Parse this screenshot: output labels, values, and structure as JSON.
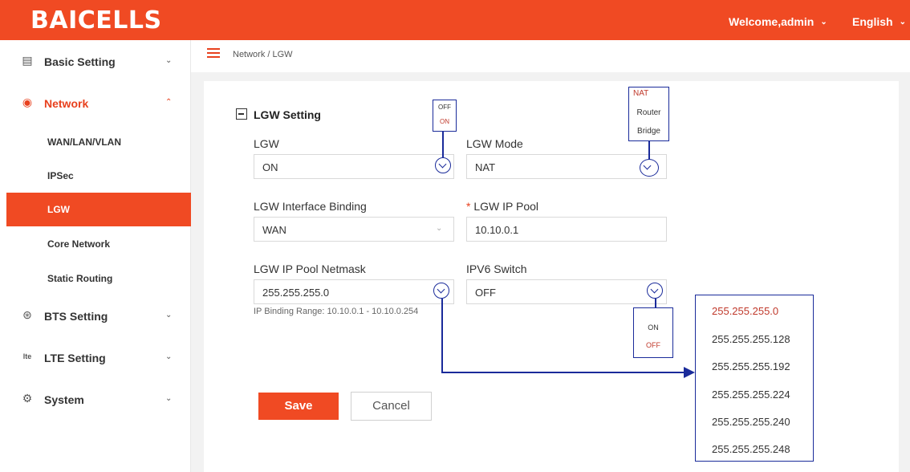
{
  "header": {
    "logo": "BAICELLS",
    "welcome": "Welcome,admin",
    "language": "English"
  },
  "sidebar": {
    "menus": [
      {
        "label": "Basic Setting",
        "icon": "document-icon"
      },
      {
        "label": "Network",
        "icon": "globe-icon"
      },
      {
        "label": "BTS Setting",
        "icon": "antenna-icon"
      },
      {
        "label": "LTE Setting",
        "icon": "lte-icon"
      },
      {
        "label": "System",
        "icon": "gear-icon"
      }
    ],
    "network_items": [
      "WAN/LAN/VLAN",
      "IPSec",
      "LGW",
      "Core Network",
      "Static Routing"
    ]
  },
  "breadcrumb": "Network / LGW",
  "section_title": "LGW Setting",
  "form": {
    "lgw": {
      "label": "LGW",
      "value": "ON"
    },
    "lgw_mode": {
      "label": "LGW Mode",
      "value": "NAT"
    },
    "binding": {
      "label": "LGW Interface Binding",
      "value": "WAN"
    },
    "ip_pool": {
      "label": "LGW IP Pool",
      "required": "*",
      "value": "10.10.0.1"
    },
    "netmask": {
      "label": "LGW IP Pool Netmask",
      "value": "255.255.255.0",
      "hint": "IP Binding Range: 10.10.0.1 - 10.10.0.254"
    },
    "ipv6": {
      "label": "IPV6 Switch",
      "value": "OFF"
    }
  },
  "callouts": {
    "lgw_options": [
      "OFF",
      "ON"
    ],
    "mode_options": [
      "NAT",
      "Router",
      "Bridge"
    ],
    "ipv6_options": [
      "ON",
      "OFF"
    ],
    "netmask_options": [
      "255.255.255.0",
      "255.255.255.128",
      "255.255.255.192",
      "255.255.255.224",
      "255.255.255.240",
      "255.255.255.248"
    ]
  },
  "buttons": {
    "save": "Save",
    "cancel": "Cancel"
  },
  "colors": {
    "brand": "#f04a23",
    "callout": "#1a2b9a",
    "selected": "#c0392b"
  }
}
